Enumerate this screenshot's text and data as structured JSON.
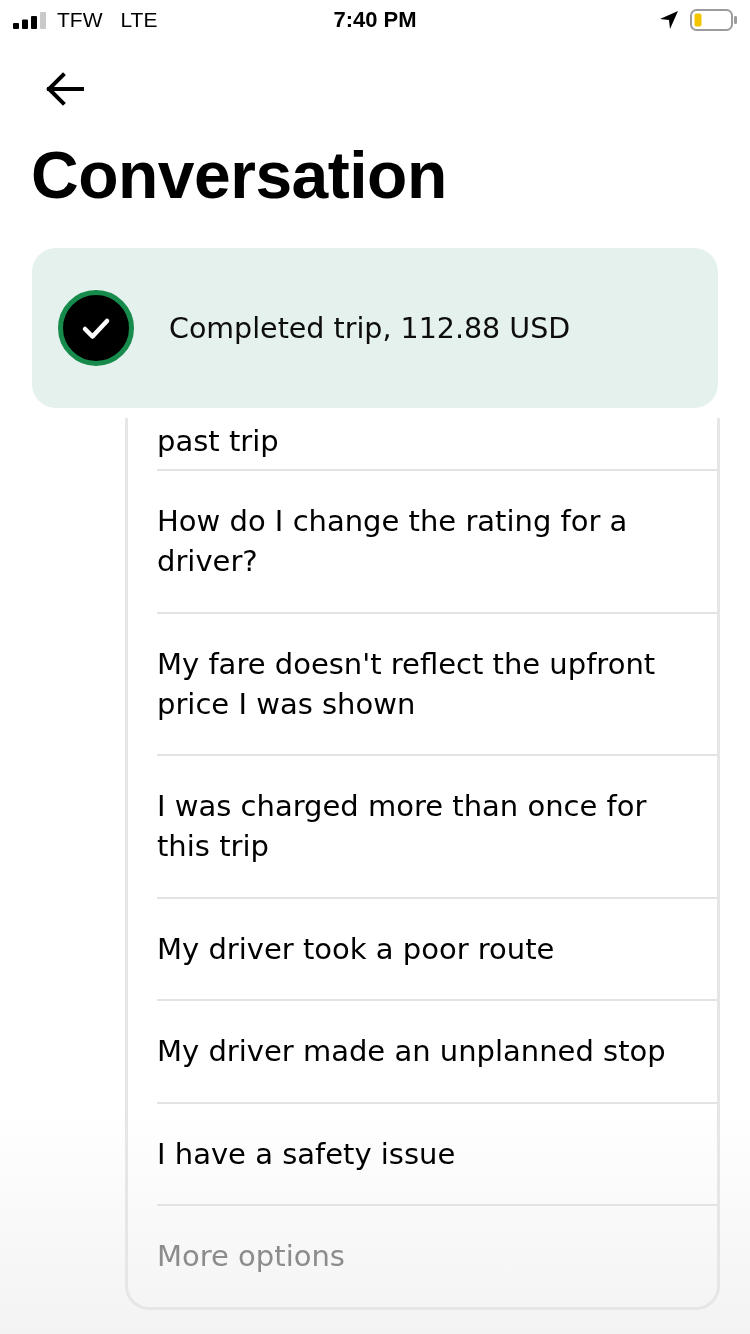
{
  "status_bar": {
    "carrier": "TFW",
    "network": "LTE",
    "time": "7:40 PM"
  },
  "title": "Conversation",
  "trip_banner": {
    "text": "Completed trip, 112.88 USD"
  },
  "options": {
    "cut_off_item": "past trip",
    "items": [
      "How do I change the rating for a driver?",
      "My fare doesn't reflect the upfront price I was shown",
      "I was charged more than once for this trip",
      "My driver took a poor route",
      "My driver made an unplanned stop",
      "I have a safety issue"
    ],
    "more": "More options"
  }
}
